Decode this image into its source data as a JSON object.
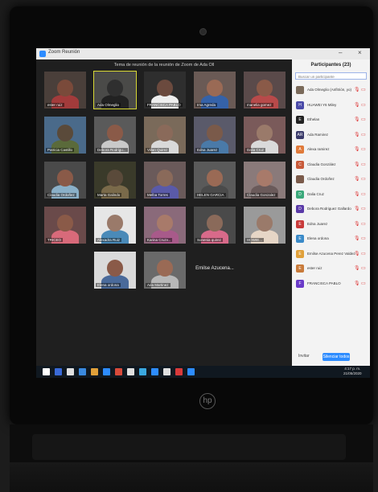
{
  "window": {
    "title": "Zoom Reunión",
    "minimize": "–",
    "close": "×"
  },
  "meeting": {
    "topic": "Tema de reunión de la reunión de Zoom de Ada Oll"
  },
  "tiles": [
    {
      "label": "ester ruiz",
      "face": "#7a4a3a",
      "body": "#a23b3b",
      "bg": "#4a3f3a"
    },
    {
      "label": "Ada Olmeglio",
      "face": "#2f2f2f",
      "body": "#222",
      "bg": "#4a4a48",
      "active": true
    },
    {
      "label": "FRANCISCA PABLO",
      "face": "#6b4a3e",
      "body": "#eeeeee",
      "bg": "#2e2e2e"
    },
    {
      "label": "Ima Agreda",
      "face": "#9a6a55",
      "body": "#3562a8",
      "bg": "#6a5a55"
    },
    {
      "label": "manelia gomez",
      "face": "#8a5a48",
      "body": "#b84a4a",
      "bg": "#5a4a4a"
    },
    {
      "label": "Patricia Castillo",
      "face": "#5a4a3a",
      "body": "#5a6a3a",
      "bg": "#4a6a8a"
    },
    {
      "label": "Debora Rodrigu...",
      "face": "#8a5a48",
      "body": "#c9c9c9",
      "bg": "#5a5a5a"
    },
    {
      "label": "Villan Quirez",
      "face": "#8a6a5a",
      "body": "#d9d9d9",
      "bg": "#7a6a5a"
    },
    {
      "label": "Edna Juarez",
      "face": "#7a5a4a",
      "body": "#4a7aa8",
      "bg": "#5a5a6a"
    },
    {
      "label": "Dalia Cruz",
      "face": "#9a7a6a",
      "body": "#dadada",
      "bg": "#7a5a5a"
    },
    {
      "label": "Claudia Ordoñez",
      "face": "#8a5a48",
      "body": "#8ab0c8",
      "bg": "#4a4a4a"
    },
    {
      "label": "Marta Galindo",
      "face": "#5a4a3a",
      "body": "#7a6a4a",
      "bg": "#3a3a2a"
    },
    {
      "label": "Melba Torres",
      "face": "#8a6a5a",
      "body": "#5a5aa8",
      "bg": "#6a5a5a"
    },
    {
      "label": "HELEN GARCIA",
      "face": "#9a6a55",
      "body": "#4a4a4a",
      "bg": "#5a5a5a"
    },
    {
      "label": "Claudia Gonzalez",
      "face": "#a87a6a",
      "body": "#6a5a5a",
      "bg": "#8a7a7a"
    },
    {
      "label": "TRICEO",
      "face": "#8a5a48",
      "body": "#d86a7a",
      "bg": "#6a4a4a"
    },
    {
      "label": "Alexadra Ruiz",
      "face": "#9a7a6a",
      "body": "#4a8ab8",
      "bg": "#e6e6e6"
    },
    {
      "label": "Karina Cruzv...",
      "face": "#a87a6a",
      "body": "#a85a8a",
      "bg": "#8a6a7a"
    },
    {
      "label": "Sonenia quirez",
      "face": "#8a6a5a",
      "body": "#d86a8a",
      "bg": "#4a4a4a"
    },
    {
      "label": "HOWIE...",
      "face": "#9a7a6a",
      "body": "#e6d6c6",
      "bg": "#9a9a9a"
    },
    {
      "label": "Elena ordona",
      "face": "#8a5a48",
      "body": "#4a6a9a",
      "bg": "#dadada"
    },
    {
      "label": "Ada Martinez",
      "face": "#9a6a55",
      "body": "#b8b8b8",
      "bg": "#6a6a6a"
    },
    {
      "label": "",
      "big": "Emilse Azucena...",
      "nameOnly": true
    }
  ],
  "participants": {
    "title": "Participantes (23)",
    "search_placeholder": "Buscar un participante",
    "items": [
      {
        "name": "Ada Olmeglio (Anfitrión, yo)",
        "color": "#7a6a5a",
        "initial": ""
      },
      {
        "name": "HUAWEI Y6 Miley",
        "color": "#4a4aa8",
        "initial": "H"
      },
      {
        "name": "Ethelan",
        "color": "#222222",
        "initial": "E"
      },
      {
        "name": "Ada Ramirez",
        "color": "#3a3a6a",
        "initial": "AR"
      },
      {
        "name": "Alexa ramirez",
        "color": "#e07a3a",
        "initial": "A"
      },
      {
        "name": "Claudia González",
        "color": "#c85a3a",
        "initial": "C"
      },
      {
        "name": "Claudia Ordoñez",
        "color": "#7a5a4a",
        "initial": ""
      },
      {
        "name": "Dalia Cruz",
        "color": "#3aa87a",
        "initial": "D"
      },
      {
        "name": "Debora Rodriguez Gallardo",
        "color": "#5a3aa8",
        "initial": "D"
      },
      {
        "name": "Edna Juarez",
        "color": "#c83a3a",
        "initial": "E"
      },
      {
        "name": "Elena ordona",
        "color": "#3a8ac8",
        "initial": "E"
      },
      {
        "name": "Emilse Azucena Perez Valdez",
        "color": "#e0a03a",
        "initial": "E"
      },
      {
        "name": "ester ruiz",
        "color": "#c87a3a",
        "initial": "E"
      },
      {
        "name": "FRANCISCA PABLO",
        "color": "#6a3ac8",
        "initial": "F"
      }
    ],
    "invite_label": "Invitar",
    "mute_all_label": "Silenciar todos"
  },
  "taskbar": {
    "time": "4:17 p. m.",
    "date": "21/05/2020",
    "icons": [
      "#ffffff",
      "#3a6ad8",
      "#e0e0e0",
      "#3a8ae0",
      "#e0a03a",
      "#2d8cff",
      "#d84a3a",
      "#e0e0e0",
      "#3aa8e0",
      "#2d8cff",
      "#e0e0e0",
      "#d83a3a",
      "#2d8cff"
    ]
  },
  "brand": {
    "logo": "hp"
  }
}
